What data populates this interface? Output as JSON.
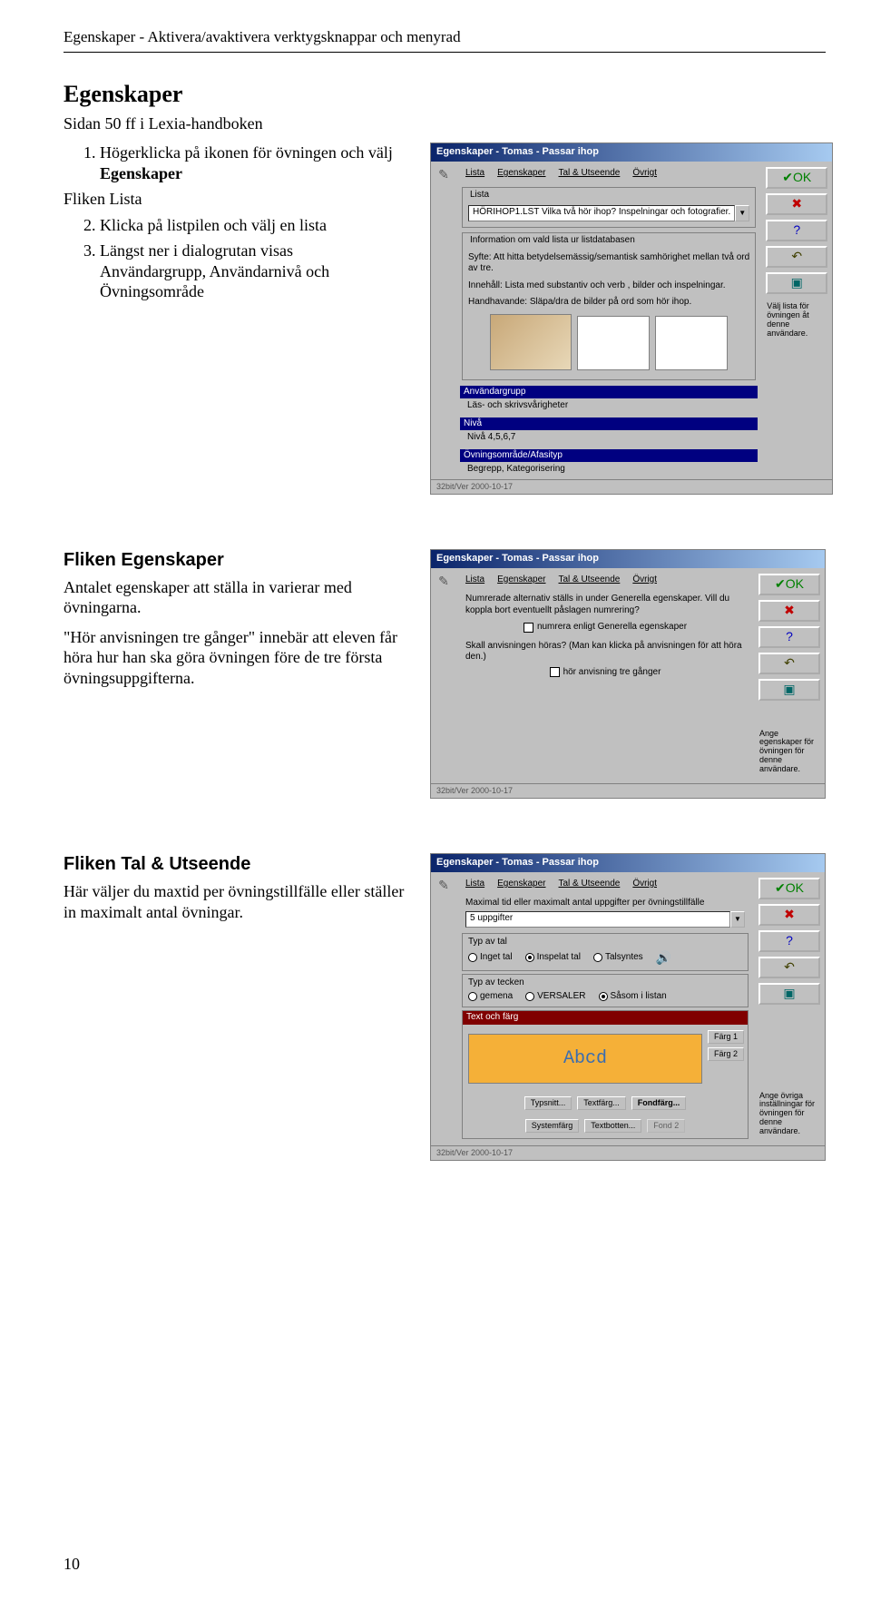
{
  "header": "Egenskaper - Aktivera/avaktivera verktygsknappar och menyrad",
  "section1": {
    "title": "Egenskaper",
    "subline": "Sidan 50 ff i Lexia-handboken",
    "step1_pre": "Högerklicka på ikonen för övningen och välj ",
    "step1_bold": "Egenskaper",
    "subhead": "Fliken Lista",
    "step2": "Klicka på listpilen och välj en lista",
    "step3": "Längst ner i dialogrutan visas Användargrupp, Användarnivå och Övningsområde"
  },
  "shot1": {
    "title": "Egenskaper - Tomas - Passar ihop",
    "tabs": [
      "Lista",
      "Egenskaper",
      "Tal & Utseende",
      "Övrigt"
    ],
    "group_lista": "Lista",
    "combo": "HÖRIHOP1.LST  Vilka två hör ihop? Inspelningar och fotografier.",
    "info_hdr": "Information om vald lista ur listdatabasen",
    "info_syfte": "Syfte: Att hitta betydelsemässig/semantisk samhörighet mellan två ord av tre.",
    "info_innehall": "Innehåll: Lista med substantiv och verb , bilder och inspelningar.",
    "info_handhavande": "Handhavande: Släpa/dra de bilder på ord som hör ihop.",
    "anv_grupp_hdr": "Användargrupp",
    "anv_grupp_val": "Läs- och skrivsvårigheter",
    "niva_hdr": "Nivå",
    "niva_val": "Nivå 4,5,6,7",
    "omrade_hdr": "Övningsområde/Afasityp",
    "omrade_val": "Begrepp, Kategorisering",
    "right_caption": "Välj lista för övningen åt denne användare.",
    "footer": "32bit/Ver 2000-10-17",
    "ok": "✔OK"
  },
  "section2": {
    "title": "Fliken Egenskaper",
    "p1": "Antalet egenskaper att ställa in varierar med övningarna.",
    "p2": "\"Hör anvisningen tre gånger\" innebär att eleven får höra hur han ska göra övningen före de tre första övningsuppgifterna."
  },
  "shot2": {
    "title": "Egenskaper - Tomas - Passar ihop",
    "line1": "Numrerade alternativ ställs in under Generella egenskaper. Vill du koppla bort eventuellt påslagen numrering?",
    "check1": "numrera enligt Generella egenskaper",
    "line2": "Skall anvisningen höras? (Man kan klicka på anvisningen för att höra den.)",
    "check2": "hör anvisning tre gånger",
    "right_caption": "Ange egenskaper för övningen för denne användare.",
    "footer": "32bit/Ver 2000-10-17"
  },
  "section3": {
    "title": "Fliken Tal & Utseende",
    "p1": "Här väljer du maxtid per övningstillfälle eller ställer in maximalt antal övningar."
  },
  "shot3": {
    "title": "Egenskaper - Tomas - Passar ihop",
    "maxline": "Maximal tid eller maximalt antal uppgifter per övningstillfälle",
    "combo": "5 uppgifter",
    "typ_tal": "Typ av tal",
    "r_inget": "Inget tal",
    "r_inspelat": "Inspelat tal",
    "r_talsyntes": "Talsyntes",
    "typ_tecken": "Typ av tecken",
    "r_gemena": "gemena",
    "r_versaler": "VERSALER",
    "r_sasom": "Såsom i listan",
    "text_farg": "Text och färg",
    "abcd": "Abcd",
    "btn_typsnitt": "Typsnitt...",
    "btn_textfarg": "Textfärg...",
    "btn_fondfarg": "Fondfärg...",
    "btn_systemfarg": "Systemfärg",
    "btn_textbotten": "Textbotten...",
    "btn_fond2": "Fond 2",
    "btn_farg1": "Färg 1",
    "btn_farg2": "Färg 2",
    "right_caption": "Ange övriga inställningar för övningen för denne användare.",
    "footer": "32bit/Ver 2000-10-17"
  },
  "page_number": "10"
}
